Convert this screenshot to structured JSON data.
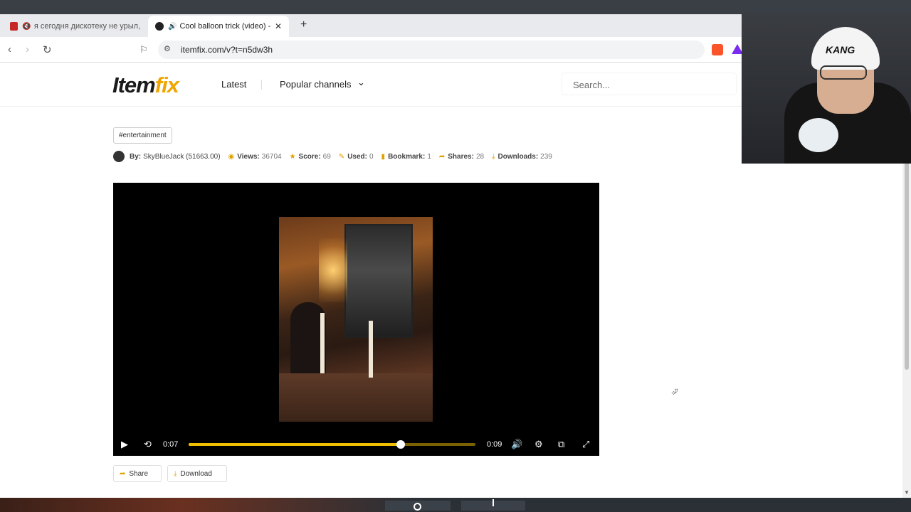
{
  "browser": {
    "tabs": [
      {
        "label": "я сегодня дискотеку не урыл, а",
        "active": false
      },
      {
        "label": "Cool balloon trick (video) - It",
        "active": true
      }
    ],
    "new_tab_icon": "plus-icon",
    "url": "itemfix.com/v?t=n5dw3h"
  },
  "header": {
    "logo_item": "Item",
    "logo_fix": "fix",
    "nav_latest": "Latest",
    "nav_popular": "Popular channels",
    "search_placeholder": "Search..."
  },
  "post": {
    "tag": "#entertainment",
    "meta": {
      "by_label": "By:",
      "by_value": "SkyBlueJack (51663.00)",
      "views_label": "Views:",
      "views_value": "36704",
      "score_label": "Score:",
      "score_value": "69",
      "used_label": "Used:",
      "used_value": "0",
      "bookmark_label": "Bookmark:",
      "bookmark_value": "1",
      "shares_label": "Shares:",
      "shares_value": "28",
      "downloads_label": "Downloads:",
      "downloads_value": "239"
    }
  },
  "player": {
    "current_time": "0:07",
    "duration": "0:09",
    "progress": 0.74
  },
  "actions": {
    "share_label": "Share",
    "download_label": "Download"
  },
  "webcam": {
    "cap_text": "KANG"
  },
  "colors": {
    "accent": "#f0c000",
    "logo_fix": "#f0a500"
  }
}
